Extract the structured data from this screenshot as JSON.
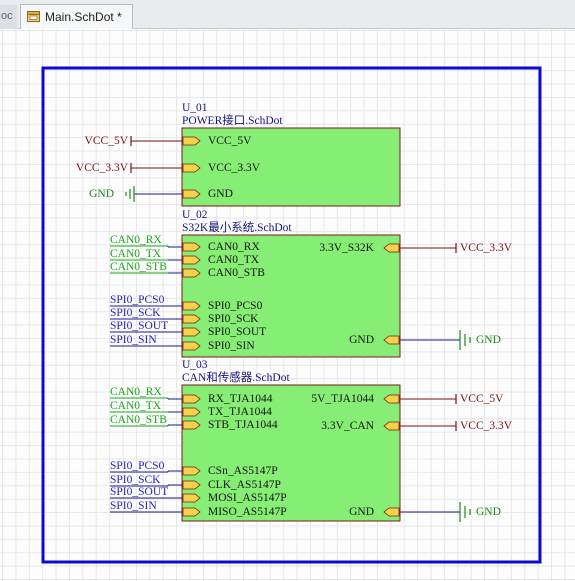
{
  "tabs": {
    "prev_label": "oc",
    "active_label": "Main.SchDot *"
  },
  "sheets": [
    {
      "designator": "U_01",
      "filename": "POWER接口.SchDot",
      "left_pins": [
        "VCC_5V",
        "VCC_3.3V",
        "GND"
      ],
      "right_pins": []
    },
    {
      "designator": "U_02",
      "filename": "S32K最小系统.SchDot",
      "left_pins": [
        "CAN0_RX",
        "CAN0_TX",
        "CAN0_STB",
        "SPI0_PCS0",
        "SPI0_SCK",
        "SPI0_SOUT",
        "SPI0_SIN"
      ],
      "right_pins": [
        "3.3V_S32K",
        "GND"
      ]
    },
    {
      "designator": "U_03",
      "filename": "CAN和传感器.SchDot",
      "left_pins": [
        "RX_TJA1044",
        "TX_TJA1044",
        "STB_TJA1044",
        "CSn_AS5147P",
        "CLK_AS5147P",
        "MOSI_AS5147P",
        "MISO_AS5147P"
      ],
      "right_pins": [
        "5V_TJA1044",
        "3.3V_CAN",
        "GND"
      ]
    }
  ],
  "power_ports": {
    "u01": [
      "VCC_5V",
      "VCC_3.3V",
      "GND"
    ],
    "u02": [
      "VCC_3.3V",
      "GND"
    ],
    "u03": [
      "VCC_5V",
      "VCC_3.3V",
      "GND"
    ]
  },
  "net_labels": {
    "u02": [
      "CAN0_RX",
      "CAN0_TX",
      "CAN0_STB",
      "SPI0_PCS0",
      "SPI0_SCK",
      "SPI0_SOUT",
      "SPI0_SIN"
    ],
    "u03": [
      "CAN0_RX",
      "CAN0_TX",
      "CAN0_STB",
      "SPI0_PCS0",
      "SPI0_SCK",
      "SPI0_SOUT",
      "SPI0_SIN"
    ]
  },
  "colors": {
    "frame": "#0a0ad6",
    "sheet_fill": "#86ee74",
    "sheet_border": "#7a1a1a",
    "wire": "#1a1a8a",
    "net_label_green": "#1aa51a",
    "net_label_blue": "#2424b8",
    "power_red": "#7a1010",
    "gnd_green": "#1a8a1a"
  }
}
